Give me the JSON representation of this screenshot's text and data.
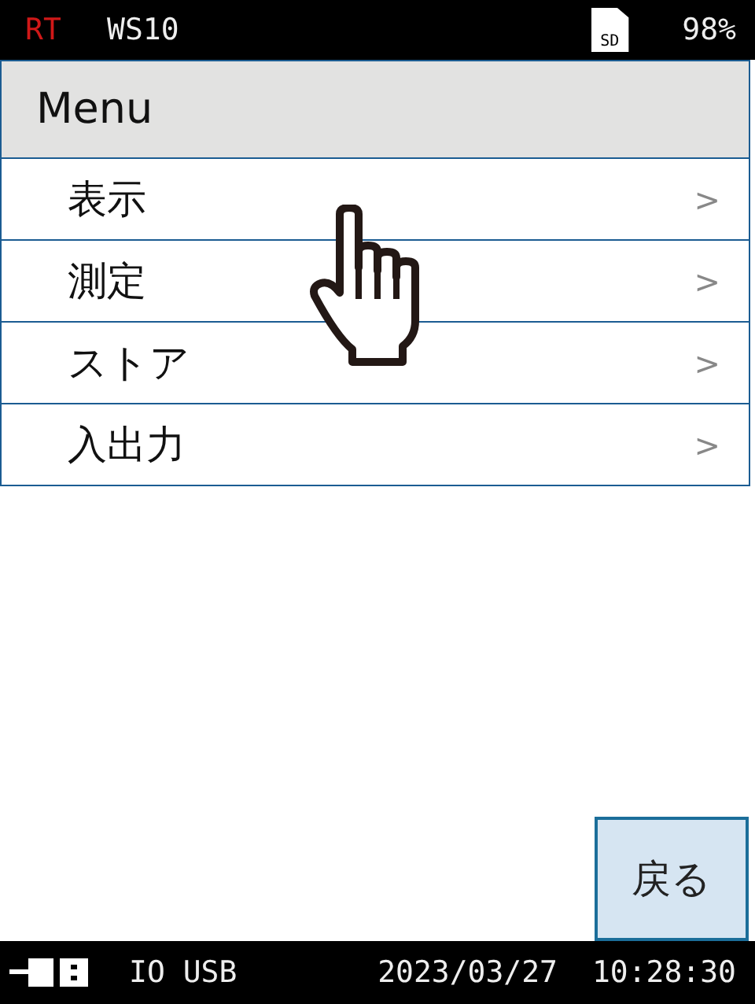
{
  "status_bar": {
    "mode": "RT",
    "station": "WS10",
    "storage": "SD",
    "battery": "98%"
  },
  "header": {
    "title": "Menu"
  },
  "menu_items": [
    {
      "label": "表示",
      "arrow": ">"
    },
    {
      "label": "測定",
      "arrow": ">"
    },
    {
      "label": "ストア",
      "arrow": ">"
    },
    {
      "label": "入出力",
      "arrow": ">"
    }
  ],
  "back_button": {
    "label": "戻る"
  },
  "bottom_bar": {
    "interface": "IO USB",
    "date": "2023/03/27",
    "time": "10:28:30"
  }
}
